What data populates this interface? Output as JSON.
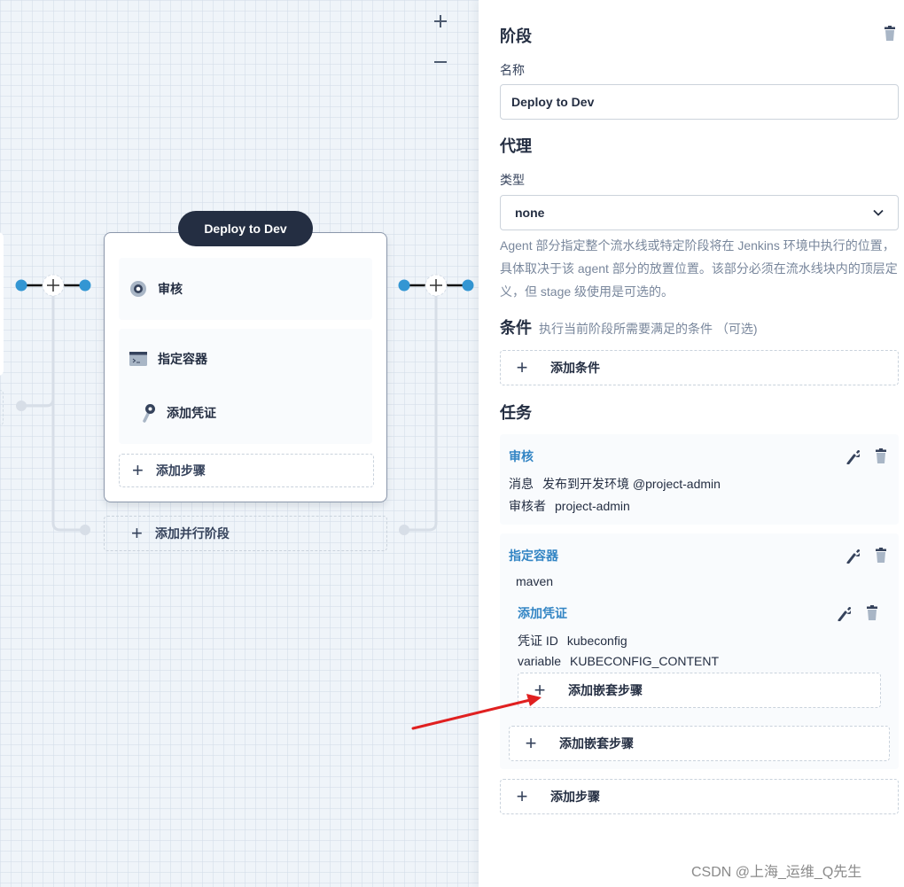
{
  "canvas": {
    "zoom_in_icon": "plus-icon",
    "zoom_out_icon": "minus-icon",
    "stage": {
      "title": "Deploy to Dev",
      "steps": [
        {
          "icon": "review-icon",
          "label": "审核"
        },
        {
          "icon": "terminal-icon",
          "label": "指定容器"
        },
        {
          "icon": "key-icon",
          "label": "添加凭证"
        }
      ],
      "add_step_label": "添加步骤"
    },
    "add_parallel_label": "添加并行阶段",
    "colors": {
      "connector_dot": "#3396d3",
      "stage_title_bg": "#242e42"
    }
  },
  "panel": {
    "stage_heading": "阶段",
    "name_label": "名称",
    "name_value": "Deploy to Dev",
    "agent_heading": "代理",
    "type_label": "类型",
    "type_value": "none",
    "agent_help": "Agent 部分指定整个流水线或特定阶段将在 Jenkins 环境中执行的位置， 具体取决于该 agent 部分的放置位置。该部分必须在流水线块内的顶层定义，但 stage 级使用是可选的。",
    "conditions_heading": "条件",
    "conditions_sub": "执行当前阶段所需要满足的条件 （可选)",
    "add_condition_label": "添加条件",
    "tasks_heading": "任务",
    "tasks": [
      {
        "title": "审核",
        "fields": [
          {
            "key": "消息",
            "value": "发布到开发环境 @project-admin"
          },
          {
            "key": "审核者",
            "value": "project-admin"
          }
        ]
      },
      {
        "title": "指定容器",
        "value": "maven",
        "nested": {
          "title": "添加凭证",
          "fields": [
            {
              "key": "凭证 ID",
              "value": "kubeconfig"
            },
            {
              "key": "variable",
              "value": "KUBECONFIG_CONTENT"
            }
          ],
          "add_nested_label": "添加嵌套步骤"
        },
        "add_nested_label": "添加嵌套步骤"
      }
    ],
    "add_step_label": "添加步骤",
    "accent_color": "#3385c4"
  },
  "watermark": "CSDN @上海_运维_Q先生"
}
